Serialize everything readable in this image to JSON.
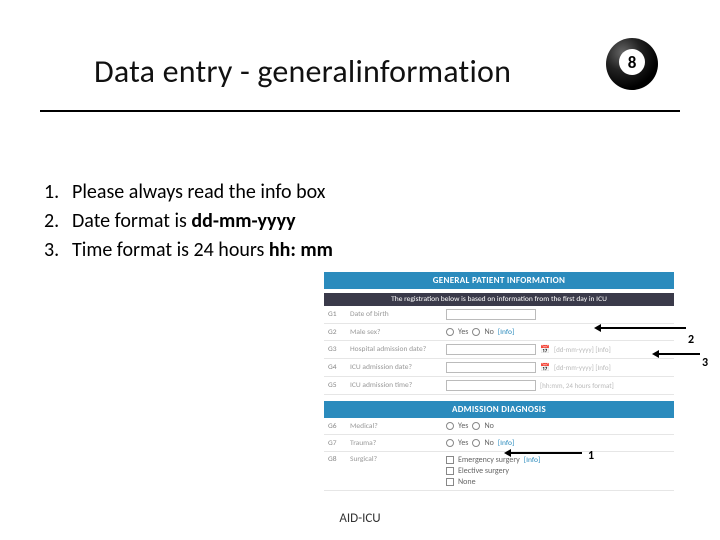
{
  "title": "Data entry - generalinformation",
  "ball_number": "8",
  "bullets": [
    {
      "num": "1.",
      "text_a": "Please always read the info box",
      "bold": "",
      "text_b": ""
    },
    {
      "num": "2.",
      "text_a": "Date format is ",
      "bold": "dd-mm-yyyy",
      "text_b": ""
    },
    {
      "num": "3.",
      "text_a": "Time format is 24 hours ",
      "bold": "hh: mm",
      "text_b": ""
    }
  ],
  "form": {
    "banner": "GENERAL PATIENT INFORMATION",
    "subbanner": "The registration below is based on information from the first day in ICU",
    "rows": [
      {
        "code": "G1",
        "label": "Date of birth",
        "type": "input",
        "hint": ""
      },
      {
        "code": "G2",
        "label": "Male sex?",
        "type": "yesno",
        "hint": "[Info]"
      },
      {
        "code": "G3",
        "label": "Hospital admission date?",
        "type": "inputcal",
        "hint": "[dd-mm-yyyy] [Info]"
      },
      {
        "code": "G4",
        "label": "ICU admission date?",
        "type": "inputcal",
        "hint": "[dd-mm-yyyy] [Info]"
      },
      {
        "code": "G5",
        "label": "ICU admission time?",
        "type": "input",
        "hint": "[hh:mm, 24 hours format]"
      }
    ],
    "banner2": "ADMISSION DIAGNOSIS",
    "rows2": [
      {
        "code": "G6",
        "label": "Medical?",
        "type": "yesno",
        "hint": ""
      },
      {
        "code": "G7",
        "label": "Trauma?",
        "type": "yesno",
        "hint": "[Info]"
      },
      {
        "code": "G8",
        "label": "Surgical?",
        "type": "surg",
        "hint": "[Info]"
      }
    ],
    "surg_opts": [
      "Emergency surgery",
      "Elective surgery",
      "None"
    ],
    "yes": "Yes",
    "no": "No"
  },
  "callouts": {
    "c1": "1",
    "c2": "2",
    "c3": "3"
  },
  "footer": "AID-ICU"
}
